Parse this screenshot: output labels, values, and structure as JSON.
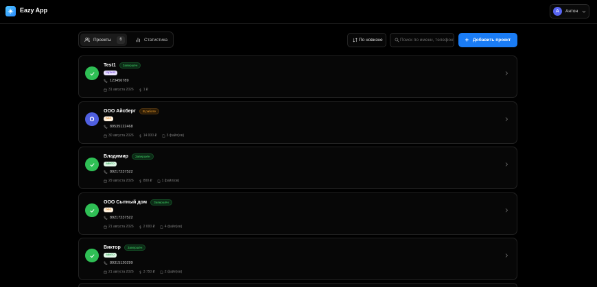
{
  "app": {
    "name": "Eazy App"
  },
  "user": {
    "initial": "А",
    "name": "Антон"
  },
  "tabs": [
    {
      "label": "Проекты",
      "count": "6",
      "icon": "users-icon"
    },
    {
      "label": "Статистика",
      "icon": "bar-chart-icon"
    }
  ],
  "sort": {
    "label": "По новизне"
  },
  "search": {
    "placeholder": "Поиск по имени, телефону"
  },
  "add_button": {
    "label": "Добавить проект"
  },
  "projects": [
    {
      "title": "Test1",
      "status": "Завершён",
      "status_type": "done",
      "tag": "taptest",
      "tag_color": "purple",
      "phone": "123456789",
      "date": "31 августа 2026",
      "amount": "1 ₽",
      "files": ""
    },
    {
      "title": "ООО Айсберг",
      "status": "В работе",
      "status_type": "work",
      "avatar": "О",
      "tag": "ооо",
      "tag_color": "orange",
      "phone": "89535122468",
      "date": "30 августа 2026",
      "amount": "14 000 ₽",
      "files": "3 файл(ов)"
    },
    {
      "title": "Владимир",
      "status": "Завершён",
      "status_type": "done",
      "tag": "авито",
      "tag_color": "green",
      "phone": "89217237522",
      "date": "29 августа 2026",
      "amount": "800 ₽",
      "files": "1 файл(ов)"
    },
    {
      "title": "ООО Сытный дом",
      "status": "Завершён",
      "status_type": "done",
      "tag": "ооо",
      "tag_color": "orange",
      "phone": "89217237522",
      "date": "21 августа 2026",
      "amount": "2 000 ₽",
      "files": "4 файл(ов)"
    },
    {
      "title": "Виктор",
      "status": "Завершён",
      "status_type": "done",
      "tag": "авито",
      "tag_color": "green",
      "phone": "89315120299",
      "date": "21 августа 2026",
      "amount": "3 750 ₽",
      "files": "2 файл(ов)"
    }
  ],
  "colors": {
    "accent": "#1a7cf5",
    "done": "#2fbf55",
    "work": "#4f5fe0",
    "background": "#000000"
  }
}
